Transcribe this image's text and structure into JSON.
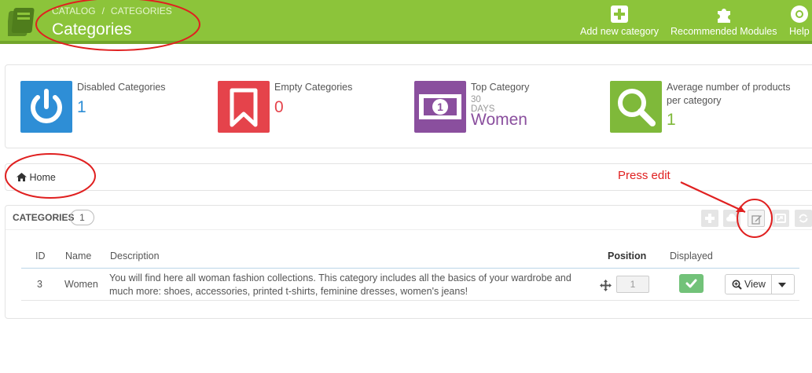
{
  "header": {
    "breadcrumb": [
      "CATALOG",
      "CATEGORIES"
    ],
    "breadcrumb_sep": "/",
    "title": "Categories",
    "toolbar": {
      "add_label": "Add new category",
      "modules_label": "Recommended Modules",
      "help_label": "Help"
    },
    "icons": [
      "catalog-logo-icon",
      "plus-square-icon",
      "puzzle-icon",
      "lifebuoy-icon"
    ]
  },
  "kpis": [
    {
      "label": "Disabled Categories",
      "sub": "",
      "value": "1",
      "color": "#2e8ed6",
      "icon": "power-icon"
    },
    {
      "label": "Empty Categories",
      "sub": "",
      "value": "0",
      "color": "#e5434b",
      "icon": "bookmark-icon"
    },
    {
      "label": "Top Category",
      "sub": "30 DAYS",
      "value": "Women",
      "color": "#8a4f9e",
      "icon": "banknote-icon"
    },
    {
      "label_line1": "Average number of products",
      "label_line2": "per category",
      "value": "1",
      "color": "#7fb93a",
      "icon": "search-icon"
    }
  ],
  "crumb": {
    "home": "Home"
  },
  "categories_panel": {
    "title": "CATEGORIES",
    "count": "1",
    "columns": {
      "id": "ID",
      "name": "Name",
      "description": "Description",
      "position": "Position",
      "displayed": "Displayed"
    },
    "rows": [
      {
        "id": "3",
        "name": "Women",
        "description_line1": "You will find here all woman fashion collections. This category includes all the basics of your wardrobe and",
        "description_line2": "much more: shoes, accessories, printed t-shirts, feminine dresses, women's jeans!",
        "position": "1",
        "displayed": true,
        "view_label": "View"
      }
    ]
  },
  "annotation": {
    "text": "Press edit",
    "color": "#e02020"
  },
  "colors": {
    "header_green": "#8cc43a",
    "displayed_green": "#72c279"
  }
}
